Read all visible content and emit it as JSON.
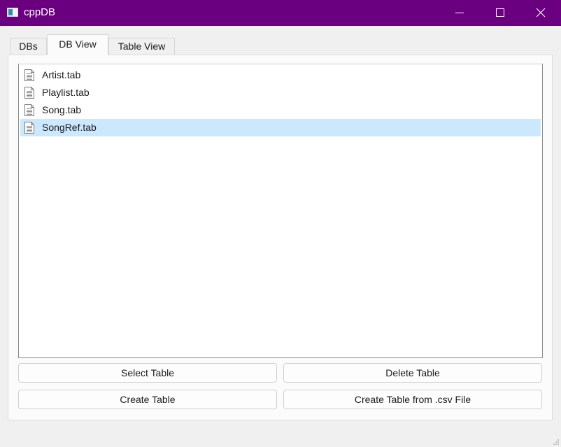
{
  "window": {
    "title": "cppDB",
    "titlebar_color": "#6a0080",
    "controls": [
      "minimize-icon",
      "maximize-icon",
      "close-icon"
    ]
  },
  "tabs": [
    {
      "label": "DBs",
      "active": false
    },
    {
      "label": "DB View",
      "active": true
    },
    {
      "label": "Table View",
      "active": false
    }
  ],
  "table_list": {
    "item_icon": "document-icon",
    "selection_color": "#cce8ff",
    "items": [
      {
        "label": "Artist.tab",
        "selected": false
      },
      {
        "label": "Playlist.tab",
        "selected": false
      },
      {
        "label": "Song.tab",
        "selected": false
      },
      {
        "label": "SongRef.tab",
        "selected": true
      }
    ]
  },
  "buttons": {
    "select_table": "Select Table",
    "delete_table": "Delete Table",
    "create_table": "Create Table",
    "create_from_csv": "Create Table from .csv File"
  }
}
